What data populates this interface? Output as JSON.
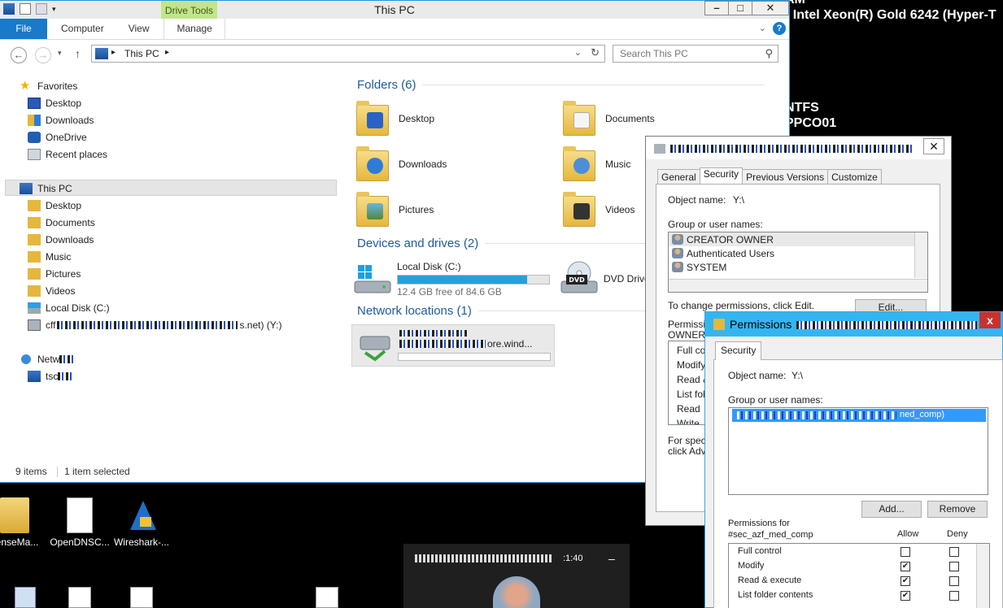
{
  "bginfo": {
    "lines": [
      "AM",
      ": Intel Xeon(R) Gold 6242 (Hyper-T",
      "",
      "",
      "",
      "",
      "NTFS",
      "PPCO01"
    ]
  },
  "desktop": {
    "icons": [
      {
        "label": "censeMa...",
        "icon": "zip-folder-icon"
      },
      {
        "label": "OpenDNSC...",
        "icon": "text-file-icon"
      },
      {
        "label": "Wireshark-...",
        "icon": "wireshark-icon"
      }
    ]
  },
  "explorer": {
    "title": "This PC",
    "context_tab": "Drive Tools",
    "tabs": {
      "file": "File",
      "computer": "Computer",
      "view": "View",
      "manage": "Manage"
    },
    "help": "?",
    "address": "This PC",
    "search_placeholder": "Search This PC",
    "nav": {
      "favorites": "Favorites",
      "fav_items": [
        "Desktop",
        "Downloads",
        "OneDrive",
        "Recent places"
      ],
      "this_pc": "This PC",
      "pc_items": [
        "Desktop",
        "Documents",
        "Downloads",
        "Music",
        "Pictures",
        "Videos",
        "Local Disk (C:)"
      ],
      "network_drive": "cff",
      "network_drive_suffix": "s.net) (Y:)",
      "network": "Netw",
      "network_host": "tsc"
    },
    "folders_header": "Folders (6)",
    "folders": [
      "Desktop",
      "Documents",
      "Downloads",
      "Music",
      "Pictures",
      "Videos"
    ],
    "devices_header": "Devices and drives (2)",
    "local_disk": {
      "name": "Local Disk (C:)",
      "free": "12.4 GB free of 84.6 GB",
      "used_fraction": 0.853
    },
    "dvd": {
      "name": "DVD Drive",
      "label": "DVD"
    },
    "network_header": "Network locations (1)",
    "network_location": {
      "suffix": "ore.wind..."
    },
    "status": {
      "items": "9 items",
      "selected": "1 item selected"
    }
  },
  "props": {
    "tabs": [
      "General",
      "Security",
      "Previous Versions",
      "Customize"
    ],
    "object_label": "Object name:",
    "object_value": "Y:\\",
    "group_label": "Group or user names:",
    "users": [
      "CREATOR OWNER",
      "Authenticated Users",
      "SYSTEM"
    ],
    "change_text": "To change permissions, click Edit.",
    "edit": "Edit...",
    "perm_label_1": "Permission",
    "perm_label_2": "OWNER",
    "perm_rows": [
      "Full con",
      "Modify",
      "Read &",
      "List fold",
      "Read",
      "Write"
    ],
    "special_1": "For special",
    "special_2": "click Adva"
  },
  "perm": {
    "title": "Permissions",
    "close": "x",
    "tab": "Security",
    "object_label": "Object name:",
    "object_value": "Y:\\",
    "group_label": "Group or user names:",
    "selected_user_suffix": "ned_comp)",
    "add": "Add...",
    "remove": "Remove",
    "for_label": "Permissions for",
    "for_group": "#sec_azf_med_comp",
    "allow": "Allow",
    "deny": "Deny",
    "rows": [
      {
        "name": "Full control",
        "allow": false,
        "deny": false
      },
      {
        "name": "Modify",
        "allow": true,
        "deny": false
      },
      {
        "name": "Read & execute",
        "allow": true,
        "deny": false
      },
      {
        "name": "List folder contents",
        "allow": true,
        "deny": false
      }
    ]
  },
  "thumb": {
    "time": ":1:40",
    "min": "–"
  }
}
